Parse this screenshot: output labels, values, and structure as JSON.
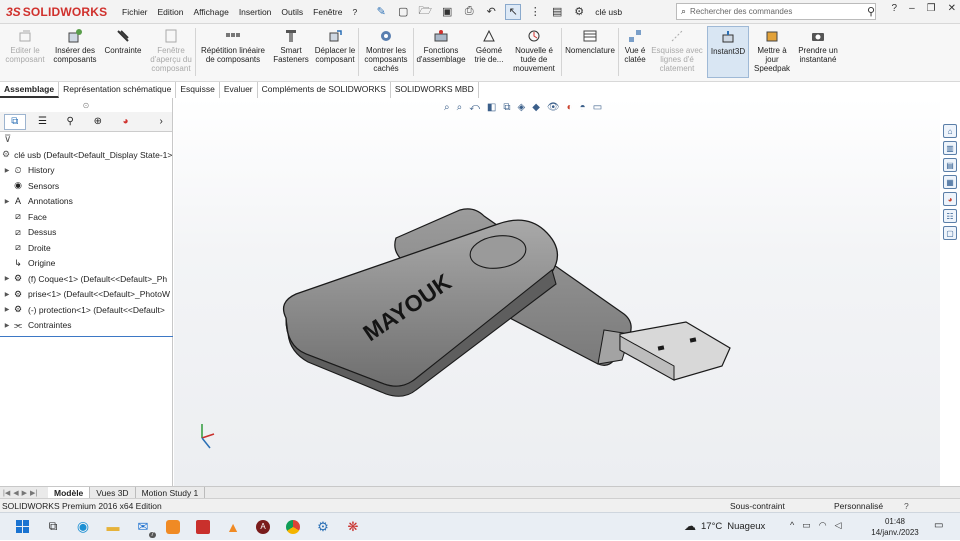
{
  "app": {
    "brand_name": "SOLIDWORKS",
    "document_name": "clé usb"
  },
  "menu": [
    "Fichier",
    "Edition",
    "Affichage",
    "Insertion",
    "Outils",
    "Fenêtre",
    "?"
  ],
  "search": {
    "placeholder": "Rechercher des commandes"
  },
  "ribbon": {
    "buttons": [
      {
        "label": "Editer le composant",
        "icon": "edit-component-icon",
        "enabled": false
      },
      {
        "label": "Insérer des composants",
        "icon": "insert-components-icon",
        "enabled": true
      },
      {
        "label": "Contrainte",
        "icon": "mate-icon",
        "enabled": true
      },
      {
        "label": "Fenêtre d'aperçu du composant",
        "icon": "component-preview-icon",
        "enabled": false
      },
      {
        "label": "Répétition linéaire de composants",
        "icon": "linear-pattern-icon",
        "enabled": true
      },
      {
        "label": "Smart Fasteners",
        "icon": "smart-fasteners-icon",
        "enabled": true
      },
      {
        "label": "Déplacer le composant",
        "icon": "move-component-icon",
        "enabled": true
      },
      {
        "label": "Montrer les composants cachés",
        "icon": "show-hidden-icon",
        "enabled": true
      },
      {
        "label": "Fonctions d'assemblage",
        "icon": "assembly-features-icon",
        "enabled": true
      },
      {
        "label": "Géomé trie de...",
        "icon": "reference-geometry-icon",
        "enabled": true
      },
      {
        "label": "Nouvelle é tude de mouvement",
        "icon": "motion-study-icon",
        "enabled": true
      },
      {
        "label": "Nomenclature",
        "icon": "bom-icon",
        "enabled": true
      },
      {
        "label": "Vue é clatée",
        "icon": "exploded-view-icon",
        "enabled": true
      },
      {
        "label": "Esquisse avec lignes d'é clatement",
        "icon": "explode-line-icon",
        "enabled": false
      },
      {
        "label": "Instant3D",
        "icon": "instant3d-icon",
        "enabled": true,
        "active": true
      },
      {
        "label": "Mettre à jour Speedpak",
        "icon": "speedpak-icon",
        "enabled": true
      },
      {
        "label": "Prendre un instantané",
        "icon": "snapshot-icon",
        "enabled": true
      }
    ]
  },
  "command_tabs": [
    "Assemblage",
    "Représentation schématique",
    "Esquisse",
    "Evaluer",
    "Compléments de SOLIDWORKS",
    "SOLIDWORKS MBD"
  ],
  "feature_tree": {
    "root": "clé usb  (Default<Default_Display State-1>",
    "items": [
      {
        "label": "History",
        "icon": "history-icon",
        "expandable": true
      },
      {
        "label": "Sensors",
        "icon": "sensor-icon",
        "expandable": false
      },
      {
        "label": "Annotations",
        "icon": "annotations-icon",
        "expandable": true
      },
      {
        "label": "Face",
        "icon": "plane-icon",
        "expandable": false
      },
      {
        "label": "Dessus",
        "icon": "plane-icon",
        "expandable": false
      },
      {
        "label": "Droite",
        "icon": "plane-icon",
        "expandable": false
      },
      {
        "label": "Origine",
        "icon": "origin-icon",
        "expandable": false
      },
      {
        "label": "(f) Coque<1> (Default<<Default>_Ph",
        "icon": "part-icon",
        "expandable": true
      },
      {
        "label": "prise<1> (Default<<Default>_PhotoW",
        "icon": "part-icon",
        "expandable": true
      },
      {
        "label": "(-) protection<1> (Default<<Default>",
        "icon": "part-icon",
        "expandable": true
      },
      {
        "label": "Contraintes",
        "icon": "mates-icon",
        "expandable": true
      }
    ]
  },
  "model": {
    "engraving_text": "MAYOUK",
    "body_color": "#8e8e8e",
    "edge_color": "#1a1a1a"
  },
  "bottom_tabs": [
    "Modèle",
    "Vues 3D",
    "Motion Study 1"
  ],
  "status": {
    "left": "SOLIDWORKS Premium 2016 x64 Edition",
    "state": "Sous-contraint",
    "units": "Personnalisé",
    "help": "?"
  },
  "taskbar": {
    "weather_temp": "17°C",
    "weather_desc": "Nuageux",
    "time": "01:48",
    "date": "14/janv./2023",
    "badge": "7"
  },
  "colors": {
    "brand": "#d0312d",
    "accent": "#3d78c5"
  }
}
